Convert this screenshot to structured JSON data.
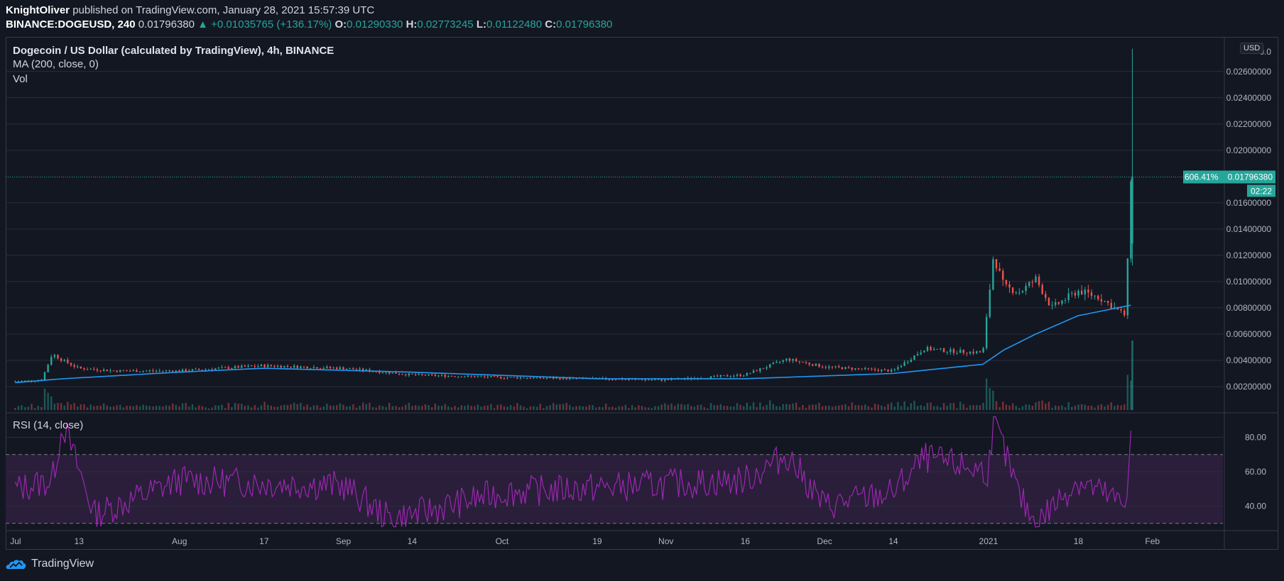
{
  "header": {
    "publisher": "KnightOliver",
    "published_text": "published on TradingView.com, January 28, 2021 15:57:39 UTC",
    "symbol": "BINANCE:DOGEUSD, 240",
    "last": "0.01796380",
    "change": "▲ +0.01035765 (+136.17%)",
    "o_label": "O:",
    "o_value": "0.01290330",
    "h_label": "H:",
    "h_value": "0.02773245",
    "l_label": "L:",
    "l_value": "0.01122480",
    "c_label": "C:",
    "c_value": "0.01796380"
  },
  "legend": {
    "title": "Dogecoin / US Dollar (calculated by TradingView), 4h, BINANCE",
    "ma": "MA (200, close, 0)",
    "vol": "Vol",
    "rsi": "RSI (14, close)"
  },
  "currency_badge": "USD",
  "price_badge": {
    "percent": "606.41%",
    "price": "0.01796380",
    "countdown": "02:22"
  },
  "footer": {
    "brand": "TradingView"
  },
  "colors": {
    "background": "#131722",
    "grid": "#2a2e39",
    "up": "#26a69a",
    "down": "#ef5350",
    "ma": "#2196f3",
    "rsi": "#9c27b0",
    "rsi_band": "#2a1e3b",
    "badge": "#26a69a"
  },
  "chart_data": [
    {
      "type": "candlestick",
      "title": "Dogecoin / US Dollar (calculated by TradingView), 4h, BINANCE",
      "x_ticks": [
        "Jul",
        "13",
        "Aug",
        "17",
        "Sep",
        "14",
        "Oct",
        "19",
        "Nov",
        "16",
        "Dec",
        "14",
        "2021",
        "18",
        "Feb"
      ],
      "y_ticks": [
        "0.02600000",
        "0.02400000",
        "0.02200000",
        "0.02000000",
        "0.01600000",
        "0.01400000",
        "0.01200000",
        "0.01000000",
        "0.00800000",
        "0.00600000",
        "0.00400000",
        "0.00200000"
      ],
      "ylim": [
        0.0,
        0.0275
      ],
      "series": [
        {
          "name": "close",
          "x": [
            "Jul 1",
            "Jul 6",
            "Jul 8",
            "Jul 10",
            "Jul 13",
            "Jul 20",
            "Aug 1",
            "Aug 17",
            "Sep 1",
            "Sep 14",
            "Oct 1",
            "Oct 19",
            "Nov 1",
            "Nov 16",
            "Nov 24",
            "Dec 1",
            "Dec 14",
            "Dec 20",
            "Dec 25",
            "Dec 31",
            "Jan 2",
            "Jan 4",
            "Jan 7",
            "Jan 10",
            "Jan 13",
            "Jan 18",
            "Jan 22",
            "Jan 27",
            "Jan 28"
          ],
          "values": [
            0.0024,
            0.0025,
            0.0045,
            0.004,
            0.0034,
            0.0032,
            0.0032,
            0.0036,
            0.0034,
            0.0029,
            0.0027,
            0.0026,
            0.0025,
            0.0029,
            0.0041,
            0.0035,
            0.0032,
            0.0049,
            0.0047,
            0.0046,
            0.012,
            0.0096,
            0.0092,
            0.0102,
            0.008,
            0.0093,
            0.0088,
            0.0074,
            0.018
          ]
        },
        {
          "name": "MA (200, close, 0)",
          "x": [
            "Jul 1",
            "Jul 10",
            "Aug 1",
            "Aug 17",
            "Sep 14",
            "Oct 19",
            "Nov 16",
            "Dec 14",
            "Dec 31",
            "Jan 4",
            "Jan 10",
            "Jan 18",
            "Jan 28"
          ],
          "values": [
            0.0023,
            0.0026,
            0.0031,
            0.0034,
            0.0031,
            0.0026,
            0.0026,
            0.003,
            0.0037,
            0.0048,
            0.006,
            0.0074,
            0.0082
          ]
        }
      ],
      "current_price": 0.0179638
    },
    {
      "type": "line",
      "title": "RSI (14, close)",
      "y_ticks": [
        "80.00",
        "60.00",
        "40.00"
      ],
      "ylim": [
        27,
        93
      ],
      "bands": [
        30,
        70
      ],
      "x": [
        "Jul 1",
        "Jul 8",
        "Jul 10",
        "Jul 16",
        "Aug 1",
        "Sep 1",
        "Sep 10",
        "Oct 1",
        "Nov 16",
        "Nov 24",
        "Dec 1",
        "Dec 14",
        "Dec 20",
        "Jan 1",
        "Jan 2",
        "Jan 7",
        "Jan 10",
        "Jan 18",
        "Jan 27",
        "Jan 28"
      ],
      "values": [
        50,
        55,
        88,
        35,
        55,
        52,
        32,
        48,
        55,
        70,
        40,
        48,
        68,
        60,
        90,
        45,
        30,
        55,
        40,
        87
      ]
    }
  ]
}
